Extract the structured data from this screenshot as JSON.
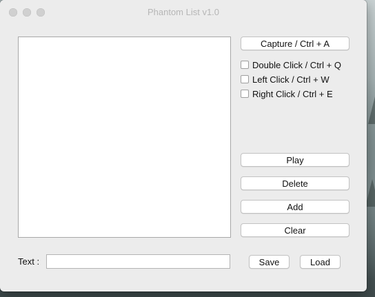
{
  "window": {
    "title": "Phantom List v1.0"
  },
  "buttons": {
    "capture": "Capture / Ctrl + A",
    "play": "Play",
    "delete": "Delete",
    "add": "Add",
    "clear": "Clear",
    "save": "Save",
    "load": "Load"
  },
  "options": {
    "double_click": "Double Click / Ctrl + Q",
    "left_click": "Left Click / Ctrl + W",
    "right_click": "Right Click / Ctrl + E"
  },
  "text_field": {
    "label": "Text :",
    "value": ""
  }
}
